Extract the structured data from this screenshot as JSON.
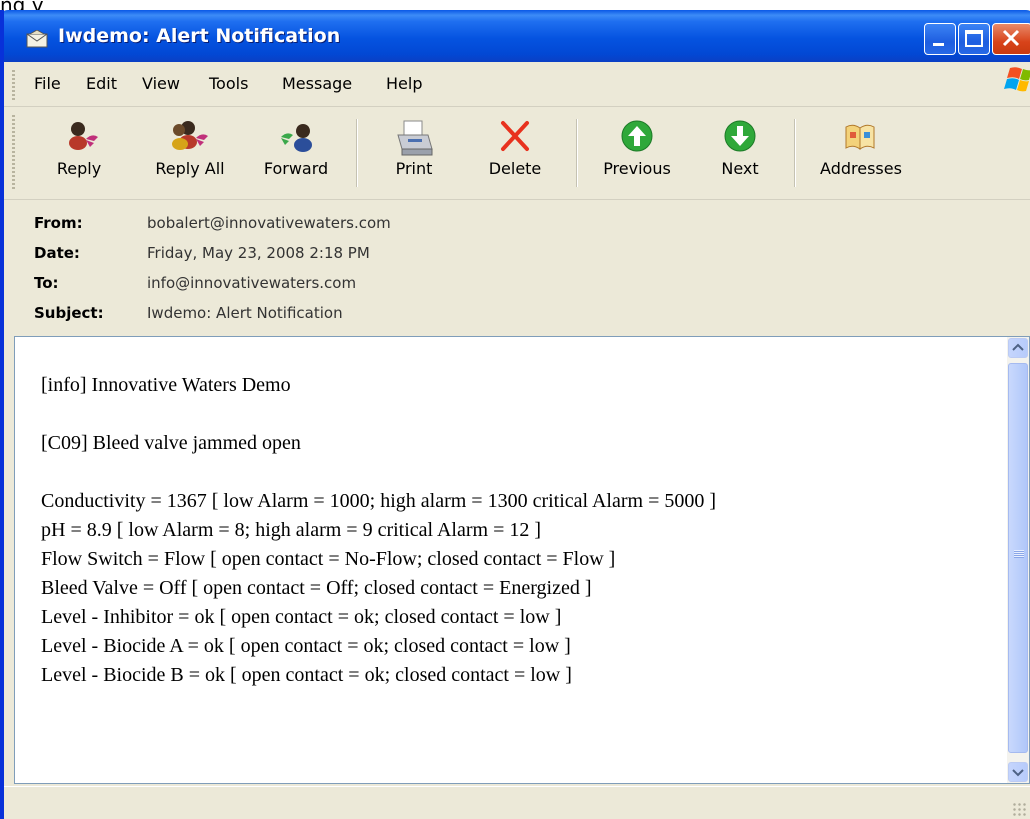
{
  "top_fragment": "ng y",
  "window": {
    "title": "Iwdemo: Alert Notification"
  },
  "menu": {
    "items": [
      "File",
      "Edit",
      "View",
      "Tools",
      "Message",
      "Help"
    ]
  },
  "toolbar": {
    "reply": "Reply",
    "reply_all": "Reply All",
    "forward": "Forward",
    "print": "Print",
    "delete": "Delete",
    "previous": "Previous",
    "next": "Next",
    "addresses": "Addresses"
  },
  "headers": {
    "from_label": "From:",
    "from": "bobalert@innovativewaters.com",
    "date_label": "Date:",
    "date": "Friday, May 23, 2008 2:18 PM",
    "to_label": "To:",
    "to": "info@innovativewaters.com",
    "subject_label": "Subject:",
    "subject": "Iwdemo: Alert Notification"
  },
  "message": {
    "line1": "[info] Innovative Waters Demo",
    "line2": "[C09] Bleed valve jammed open",
    "readings": [
      "Conductivity = 1367  [ low Alarm = 1000; high alarm = 1300 critical Alarm = 5000 ]",
      "pH = 8.9  [ low Alarm = 8; high alarm = 9 critical Alarm = 12 ]",
      "Flow Switch = Flow  [ open contact = No-Flow; closed contact = Flow ]",
      "Bleed Valve = Off  [ open contact = Off; closed contact = Energized ]",
      "Level - Inhibitor = ok  [ open contact = ok; closed contact = low ]",
      "Level - Biocide A = ok  [ open contact = ok; closed contact = low ]",
      "Level - Biocide B = ok  [ open contact = ok; closed contact = low ]"
    ]
  },
  "colors": {
    "titlebar": "#0553e0",
    "window_bg": "#ece9d8",
    "delete_red": "#e8321e",
    "nav_green": "#2fa83a"
  }
}
